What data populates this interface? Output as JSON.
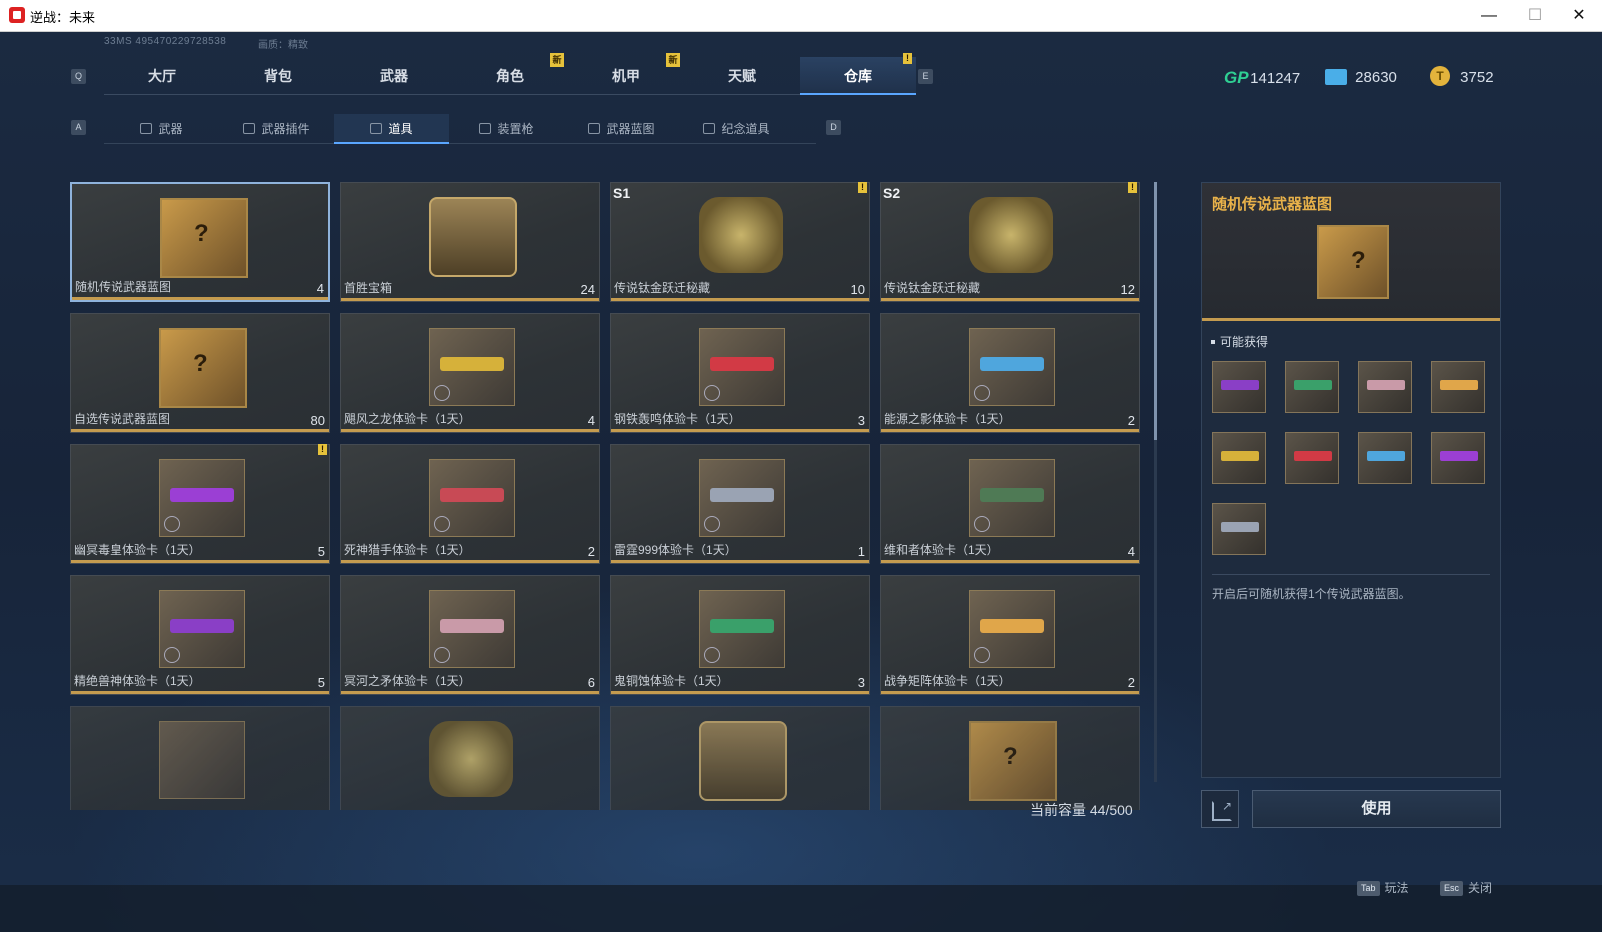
{
  "window": {
    "title": "逆战：未来",
    "min": "—",
    "max": "☐",
    "close": "✕"
  },
  "status": {
    "ping": "33MS  495470229728538",
    "quality": "画质：精致"
  },
  "keys": {
    "q": "Q",
    "e": "E",
    "a": "A",
    "d": "D"
  },
  "main_tabs": [
    {
      "label": "大厅",
      "badge": ""
    },
    {
      "label": "背包",
      "badge": ""
    },
    {
      "label": "武器",
      "badge": ""
    },
    {
      "label": "角色",
      "badge": "新"
    },
    {
      "label": "机甲",
      "badge": "新"
    },
    {
      "label": "天赋",
      "badge": ""
    },
    {
      "label": "仓库",
      "badge": "!",
      "active": true
    }
  ],
  "currency": {
    "gp": "141247",
    "gp_label": "GP",
    "c2": "28630",
    "c3": "3752"
  },
  "sub_tabs": [
    {
      "label": "武器"
    },
    {
      "label": "武器插件"
    },
    {
      "label": "道具",
      "active": true
    },
    {
      "label": "装置枪"
    },
    {
      "label": "武器蓝图"
    },
    {
      "label": "纪念道具"
    }
  ],
  "items": [
    {
      "name": "随机传说武器蓝图",
      "count": "4",
      "kind": "blueprint",
      "season": ""
    },
    {
      "name": "首胜宝箱",
      "count": "24",
      "kind": "chest",
      "season": ""
    },
    {
      "name": "传说钛金跃迁秘藏",
      "count": "10",
      "kind": "cube",
      "season": "S1"
    },
    {
      "name": "传说钛金跃迁秘藏",
      "count": "12",
      "kind": "cube",
      "season": "S2"
    },
    {
      "name": "自选传说武器蓝图",
      "count": "80",
      "kind": "blueprint",
      "season": ""
    },
    {
      "name": "飓风之龙体验卡（1天）",
      "count": "4",
      "kind": "weapon",
      "color": "#d6b13a"
    },
    {
      "name": "钢铁轰鸣体验卡（1天）",
      "count": "3",
      "kind": "weapon",
      "color": "#d23a45"
    },
    {
      "name": "能源之影体验卡（1天）",
      "count": "2",
      "kind": "weapon",
      "color": "#4fa6dd"
    },
    {
      "name": "幽冥毒皇体验卡（1天）",
      "count": "5",
      "kind": "weapon",
      "color": "#9b3fd4"
    },
    {
      "name": "死神猎手体验卡（1天）",
      "count": "2",
      "kind": "weapon",
      "color": "#c84a55"
    },
    {
      "name": "雷霆999体验卡（1天）",
      "count": "1",
      "kind": "weapon",
      "color": "#9aa3b3"
    },
    {
      "name": "维和者体验卡（1天）",
      "count": "4",
      "kind": "weapon",
      "color": "#4f7a55"
    },
    {
      "name": "精绝兽神体验卡（1天）",
      "count": "5",
      "kind": "weapon",
      "color": "#8a3fc6"
    },
    {
      "name": "冥河之矛体验卡（1天）",
      "count": "6",
      "kind": "weapon",
      "color": "#c99aa8"
    },
    {
      "name": "鬼铜蚀体验卡（1天）",
      "count": "3",
      "kind": "weapon",
      "color": "#3aa06a"
    },
    {
      "name": "战争矩阵体验卡（1天）",
      "count": "2",
      "kind": "weapon",
      "color": "#e0a64a"
    }
  ],
  "capacity": "当前容量 44/500",
  "detail": {
    "title": "随机传说武器蓝图",
    "section": "可能获得",
    "rewards": [
      "#8a3fc6",
      "#3aa06a",
      "#c99aa8",
      "#e0a64a",
      "#d6b13a",
      "#d23a45",
      "#4fa6dd",
      "#9b3fd4",
      "#9aa3b3"
    ],
    "description": "开启后可随机获得1个传说武器蓝图。"
  },
  "use_button": "使用",
  "hints": {
    "tab_key": "Tab",
    "tab_label": "玩法",
    "esc_key": "Esc",
    "esc_label": "关闭"
  }
}
